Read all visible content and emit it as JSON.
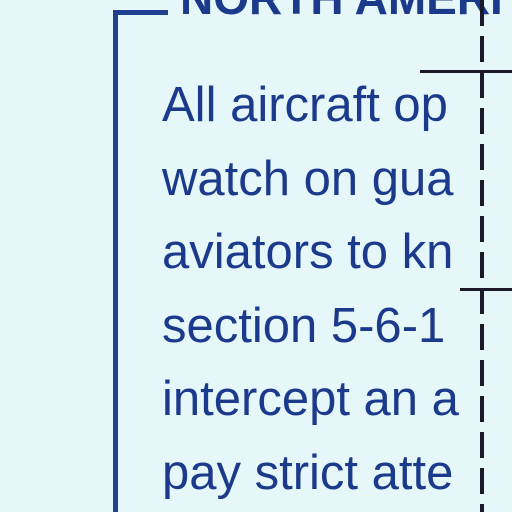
{
  "document": {
    "heading": "NORTH AMERI",
    "lines": [
      "All aircraft op",
      "watch on gua",
      "aviators to kn",
      "section 5-6-1",
      "intercept an a",
      "pay strict atte"
    ]
  },
  "colors": {
    "background": "#e6f7fa",
    "text": "#1c3a8c",
    "bracket": "#1f3f8f",
    "rule": "#1a1a2a"
  }
}
